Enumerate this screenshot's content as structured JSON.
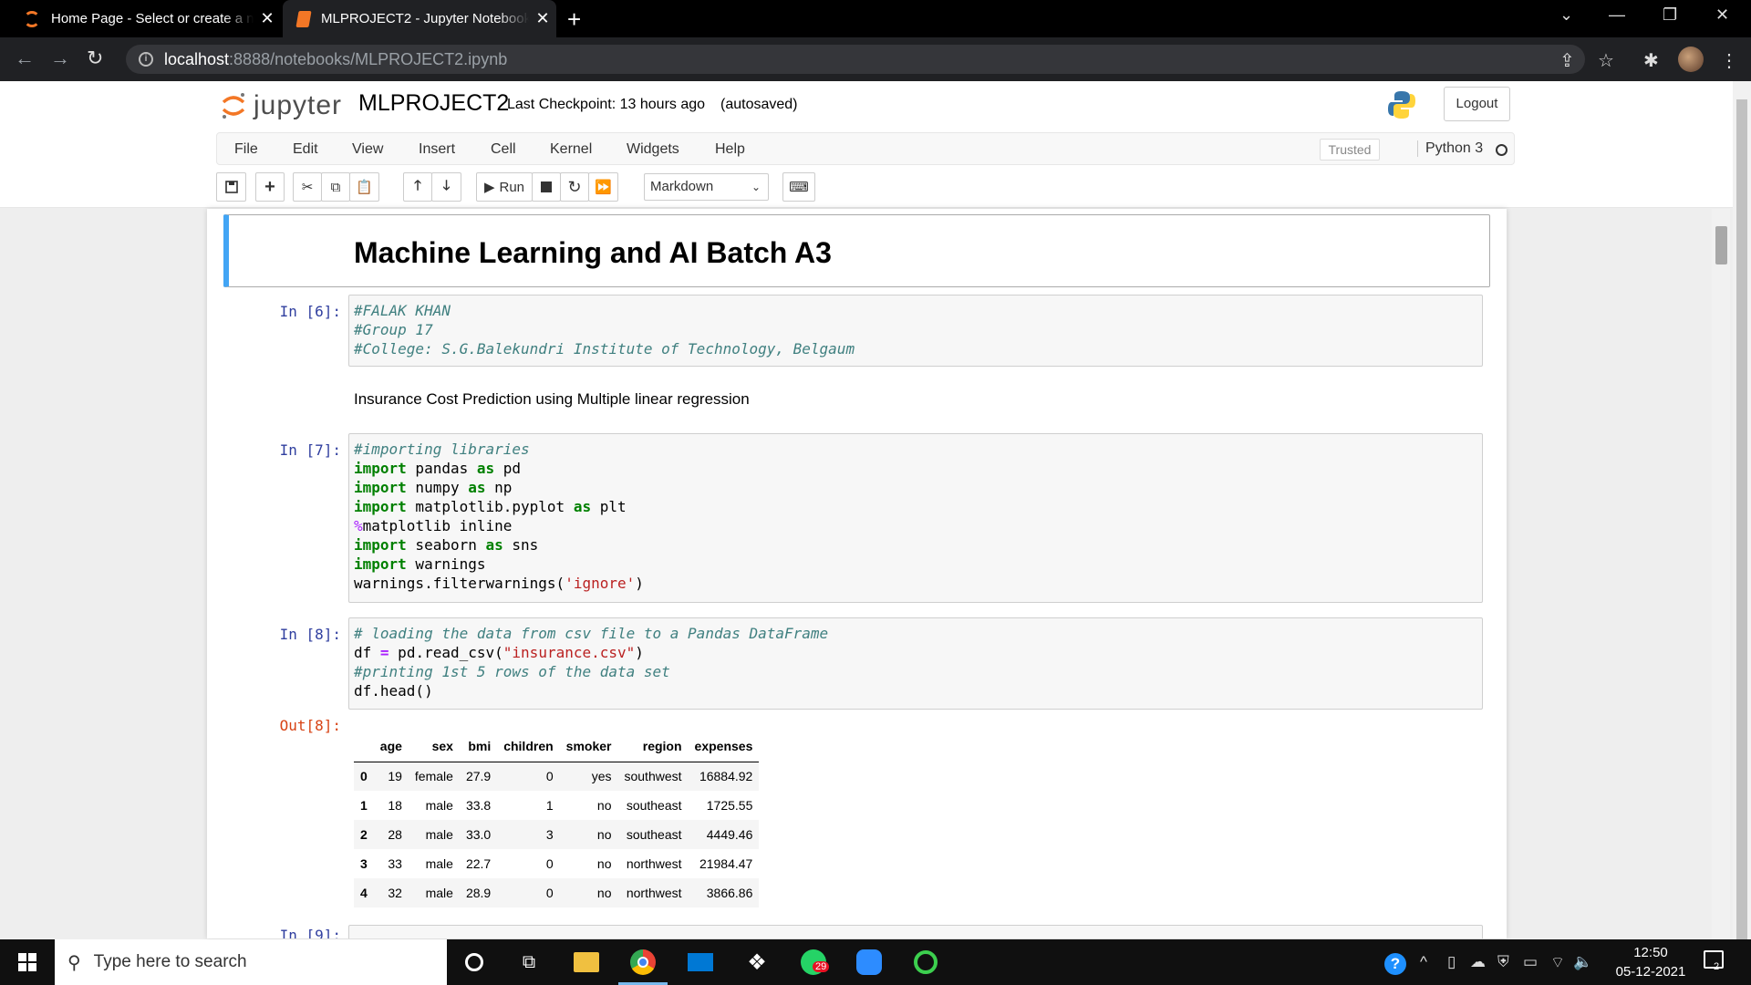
{
  "browser": {
    "tabs": [
      {
        "title": "Home Page - Select or create a n",
        "active": false
      },
      {
        "title": "MLPROJECT2 - Jupyter Notebook",
        "active": true
      }
    ],
    "url_host": "localhost",
    "url_path": ":8888/notebooks/MLPROJECT2.ipynb"
  },
  "jupyter": {
    "logo_text": "jupyter",
    "notebook_name": "MLPROJECT2",
    "checkpoint": "Last Checkpoint: 13 hours ago",
    "autosave": "(autosaved)",
    "logout_label": "Logout",
    "menu": [
      "File",
      "Edit",
      "View",
      "Insert",
      "Cell",
      "Kernel",
      "Widgets",
      "Help"
    ],
    "trusted": "Trusted",
    "kernel_name": "Python 3",
    "toolbar": {
      "run_label": "Run",
      "cell_type": "Markdown"
    }
  },
  "cells": {
    "heading": "Machine Learning and AI Batch A3",
    "cell6": {
      "prompt": "In [6]:",
      "lines": [
        "#FALAK KHAN",
        "#Group 17",
        "#College: S.G.Balekundri Institute of Technology, Belgaum"
      ]
    },
    "markdown1": "Insurance Cost Prediction using Multiple linear regression",
    "cell7": {
      "prompt": "In [7]:",
      "comment": "#importing libraries",
      "imports": [
        {
          "kw": "import",
          "mod": " pandas ",
          "as": "as",
          "alias": " pd"
        },
        {
          "kw": "import",
          "mod": " numpy ",
          "as": "as",
          "alias": " np"
        },
        {
          "kw": "import",
          "mod": " matplotlib.pyplot ",
          "as": "as",
          "alias": " plt"
        }
      ],
      "magic_pct": "%",
      "magic_rest": "matplotlib inline",
      "import_sns": {
        "kw": "import",
        "mod": " seaborn ",
        "as": "as",
        "alias": " sns"
      },
      "import_warn_kw": "import",
      "import_warn_mod": " warnings",
      "filter_pre": "warnings.filterwarnings(",
      "filter_str": "'ignore'",
      "filter_post": ")"
    },
    "cell8": {
      "prompt": "In [8]:",
      "comment1": "# loading the data from csv file to a Pandas DataFrame",
      "line2_a": "df ",
      "line2_op": "=",
      "line2_b": " pd.read_csv(",
      "line2_str": "\"insurance.csv\"",
      "line2_c": ")",
      "comment2": "#printing 1st 5 rows of the data set",
      "line4": "df.head()",
      "out_prompt": "Out[8]:"
    },
    "next_cell_partial": "In [9]:"
  },
  "dataframe": {
    "columns": [
      "",
      "age",
      "sex",
      "bmi",
      "children",
      "smoker",
      "region",
      "expenses"
    ],
    "rows": [
      [
        "0",
        "19",
        "female",
        "27.9",
        "0",
        "yes",
        "southwest",
        "16884.92"
      ],
      [
        "1",
        "18",
        "male",
        "33.8",
        "1",
        "no",
        "southeast",
        "1725.55"
      ],
      [
        "2",
        "28",
        "male",
        "33.0",
        "3",
        "no",
        "southeast",
        "4449.46"
      ],
      [
        "3",
        "33",
        "male",
        "22.7",
        "0",
        "no",
        "northwest",
        "21984.47"
      ],
      [
        "4",
        "32",
        "male",
        "28.9",
        "0",
        "no",
        "northwest",
        "3866.86"
      ]
    ]
  },
  "taskbar": {
    "search_placeholder": "Type here to search",
    "time": "12:50",
    "date": "05-12-2021",
    "whatsapp_badge": "29",
    "notification_count": "2"
  },
  "colors": {
    "selected_cell_border": "#42a5f5",
    "prompt_in": "#303f9f",
    "prompt_out": "#d84315",
    "jupyter_orange": "#f37726"
  }
}
